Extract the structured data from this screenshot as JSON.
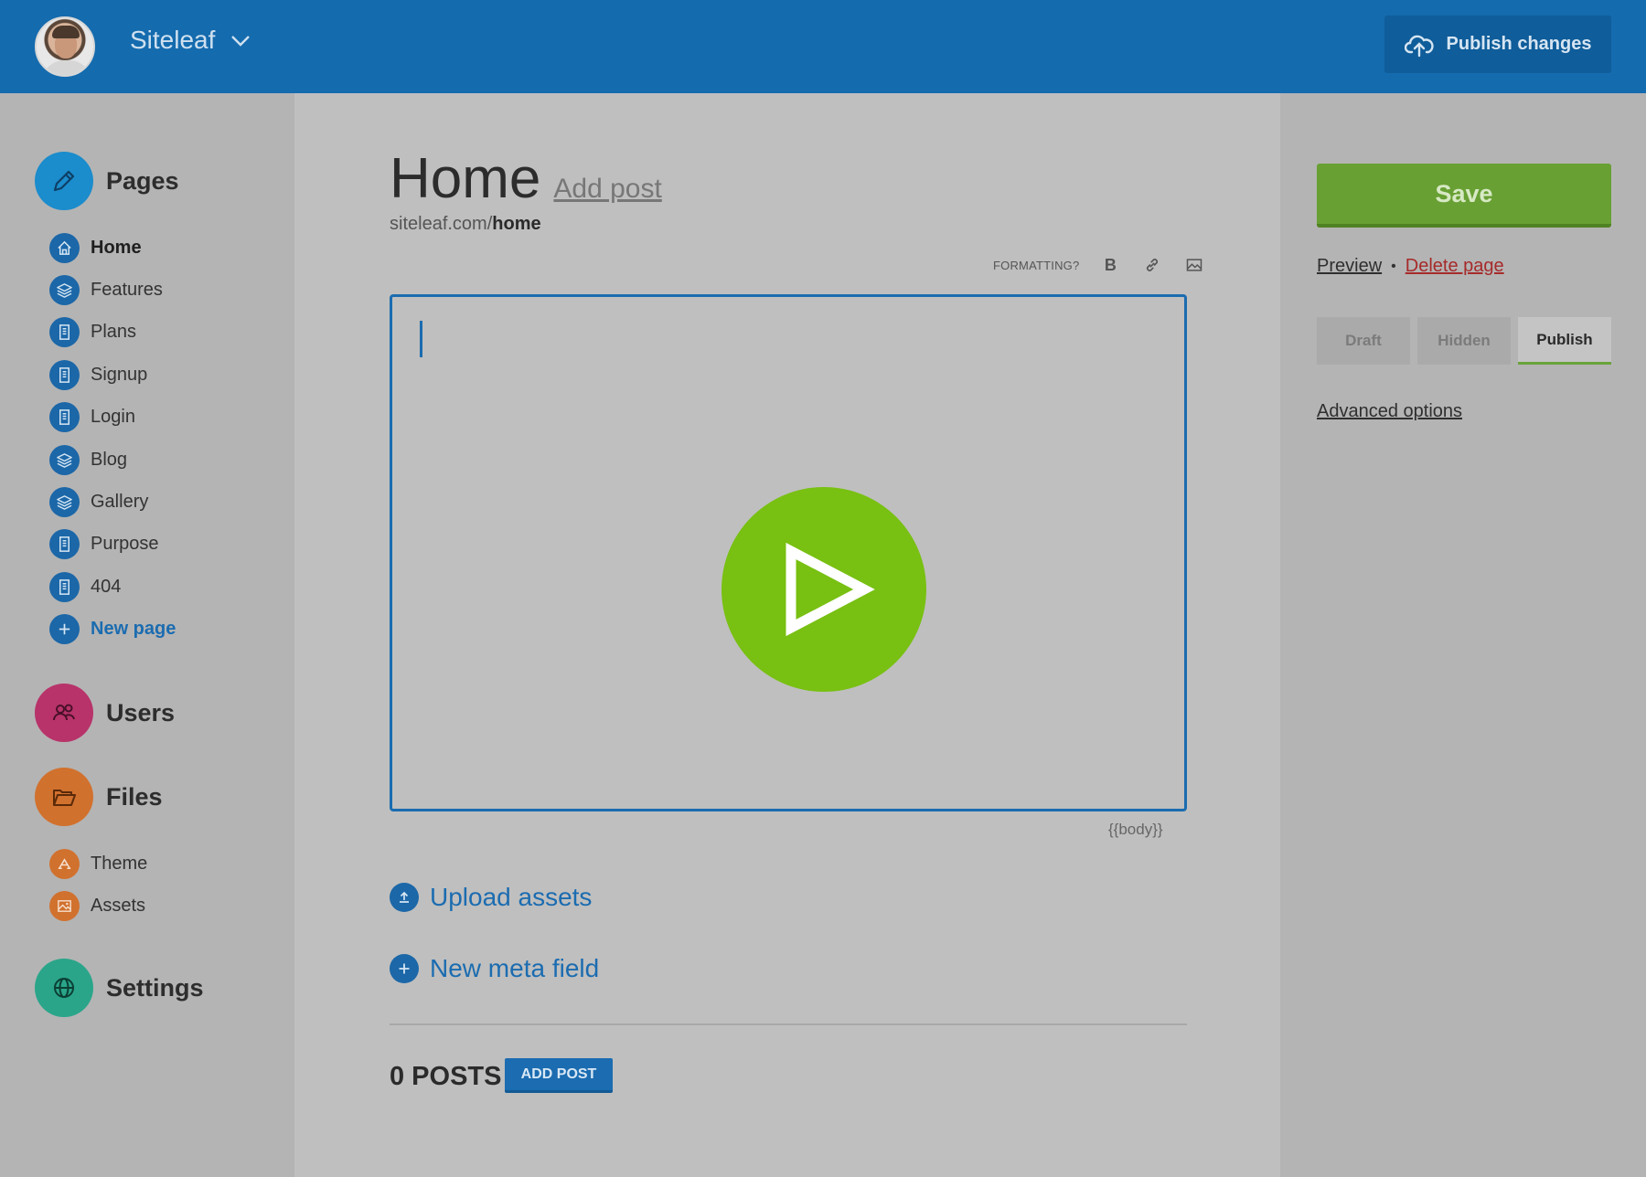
{
  "header": {
    "site_name": "Siteleaf",
    "publish_label": "Publish changes"
  },
  "sidebar": {
    "pages": {
      "label": "Pages",
      "items": [
        {
          "label": "Home",
          "icon": "home-icon"
        },
        {
          "label": "Features",
          "icon": "layers-icon"
        },
        {
          "label": "Plans",
          "icon": "document-icon"
        },
        {
          "label": "Signup",
          "icon": "document-icon"
        },
        {
          "label": "Login",
          "icon": "document-icon"
        },
        {
          "label": "Blog",
          "icon": "layers-icon"
        },
        {
          "label": "Gallery",
          "icon": "layers-icon"
        },
        {
          "label": "Purpose",
          "icon": "document-icon"
        },
        {
          "label": "404",
          "icon": "document-icon"
        },
        {
          "label": "New page",
          "icon": "plus-icon"
        }
      ]
    },
    "users": {
      "label": "Users"
    },
    "files": {
      "label": "Files",
      "items": [
        {
          "label": "Theme",
          "icon": "theme-icon"
        },
        {
          "label": "Assets",
          "icon": "image-icon"
        }
      ]
    },
    "settings": {
      "label": "Settings"
    }
  },
  "main": {
    "title": "Home",
    "add_post_link": "Add post",
    "url_prefix": "siteleaf.com/",
    "url_slug": "home",
    "formatting_label": "FORMATTING?",
    "bold_label": "B",
    "body_tag": "{{body}}",
    "upload_label": "Upload assets",
    "meta_label": "New meta field",
    "posts_count": "0 POSTS",
    "add_post_button": "ADD POST"
  },
  "right": {
    "save_label": "Save",
    "preview_label": "Preview",
    "separator": "•",
    "delete_label": "Delete page",
    "status_tabs": [
      "Draft",
      "Hidden",
      "Publish"
    ],
    "active_status": "Publish",
    "advanced_label": "Advanced options"
  },
  "colors": {
    "header": "#146bae",
    "accent_blue": "#1b6cb0",
    "users": "#b8336a",
    "files": "#d1712e",
    "settings": "#2aa58a",
    "save_green": "#68a034",
    "play_green": "#78c012",
    "delete_red": "#a62a2a"
  }
}
